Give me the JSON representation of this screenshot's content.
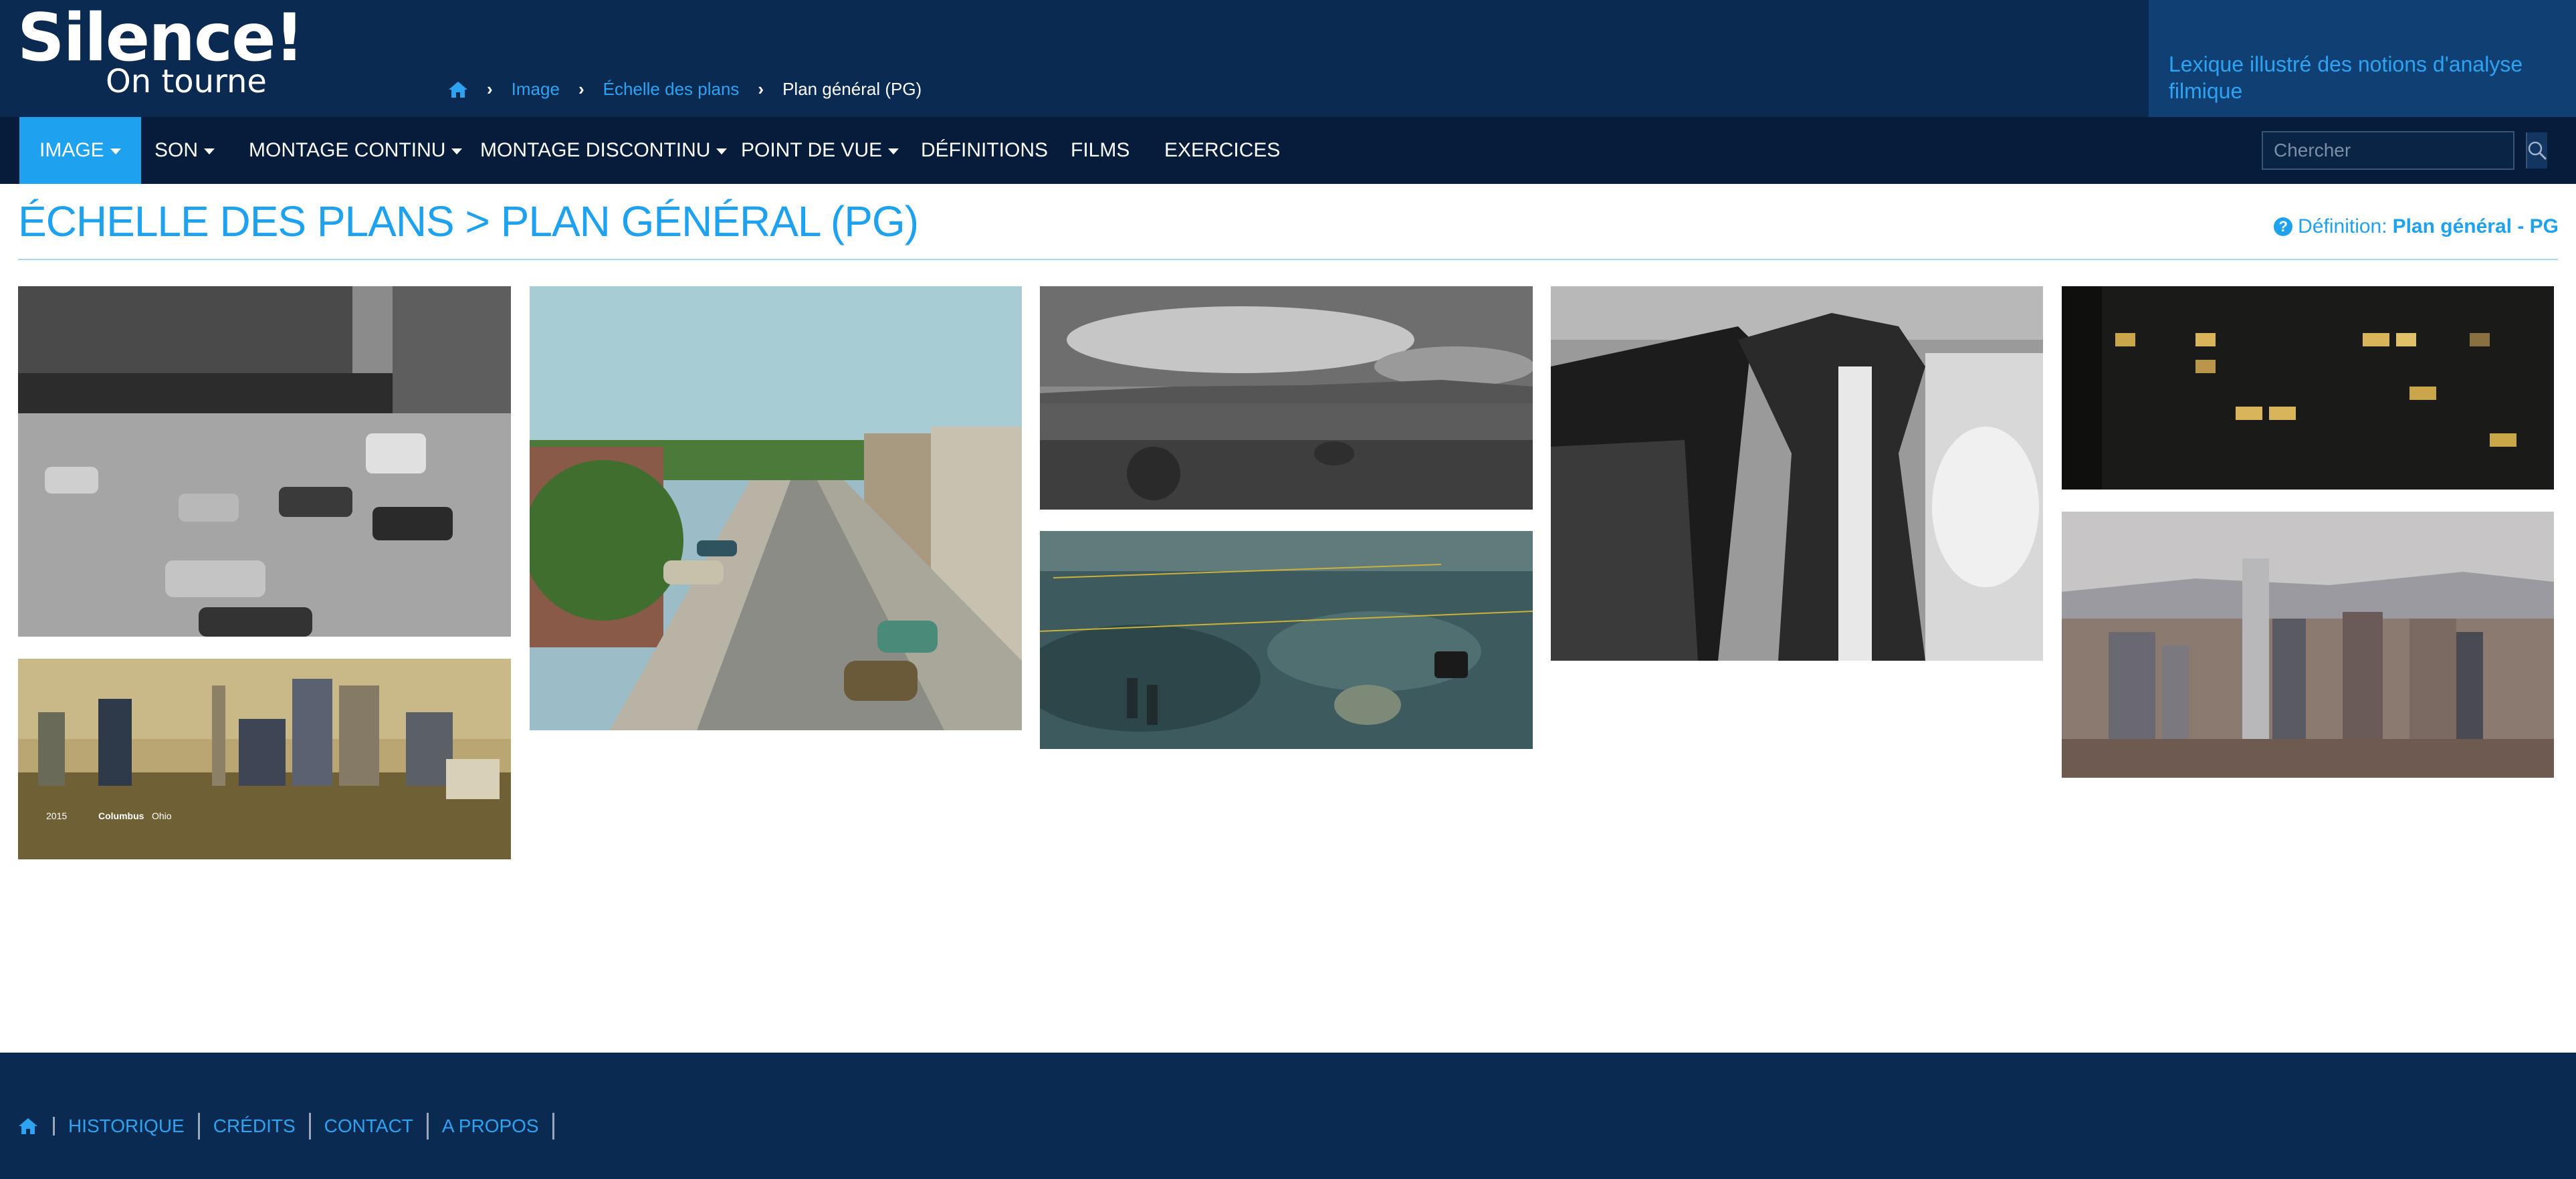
{
  "site": {
    "logo_title": "Silence!",
    "logo_subtitle": "On tourne",
    "tagline": "Lexique illustré des notions d'analyse filmique"
  },
  "breadcrumb": {
    "items": [
      "Image",
      "Échelle des plans"
    ],
    "current": "Plan général (PG)"
  },
  "nav": {
    "items": [
      {
        "label": "IMAGE",
        "dropdown": true,
        "active": true
      },
      {
        "label": "SON",
        "dropdown": true
      },
      {
        "label": "MONTAGE CONTINU",
        "dropdown": true
      },
      {
        "label": "MONTAGE DISCONTINU",
        "dropdown": true
      },
      {
        "label": "POINT DE VUE",
        "dropdown": true
      },
      {
        "label": "DÉFINITIONS"
      },
      {
        "label": "FILMS"
      },
      {
        "label": "EXERCICES"
      }
    ],
    "search_placeholder": "Chercher"
  },
  "page": {
    "title": "ÉCHELLE DES PLANS > PLAN GÉNÉRAL (PG)",
    "definition_prefix": "Définition:",
    "definition_link": "Plan général - PG"
  },
  "gallery": {
    "caption_overlay": {
      "year": "2015",
      "city": "Columbus",
      "state": "Ohio"
    }
  },
  "footer": {
    "links": [
      "HISTORIQUE",
      "CRÉDITS",
      "CONTACT",
      "A PROPOS"
    ]
  },
  "colors": {
    "header_bg": "#0b2a52",
    "nav_bg": "#061c3a",
    "accent": "#1ea1ee"
  }
}
